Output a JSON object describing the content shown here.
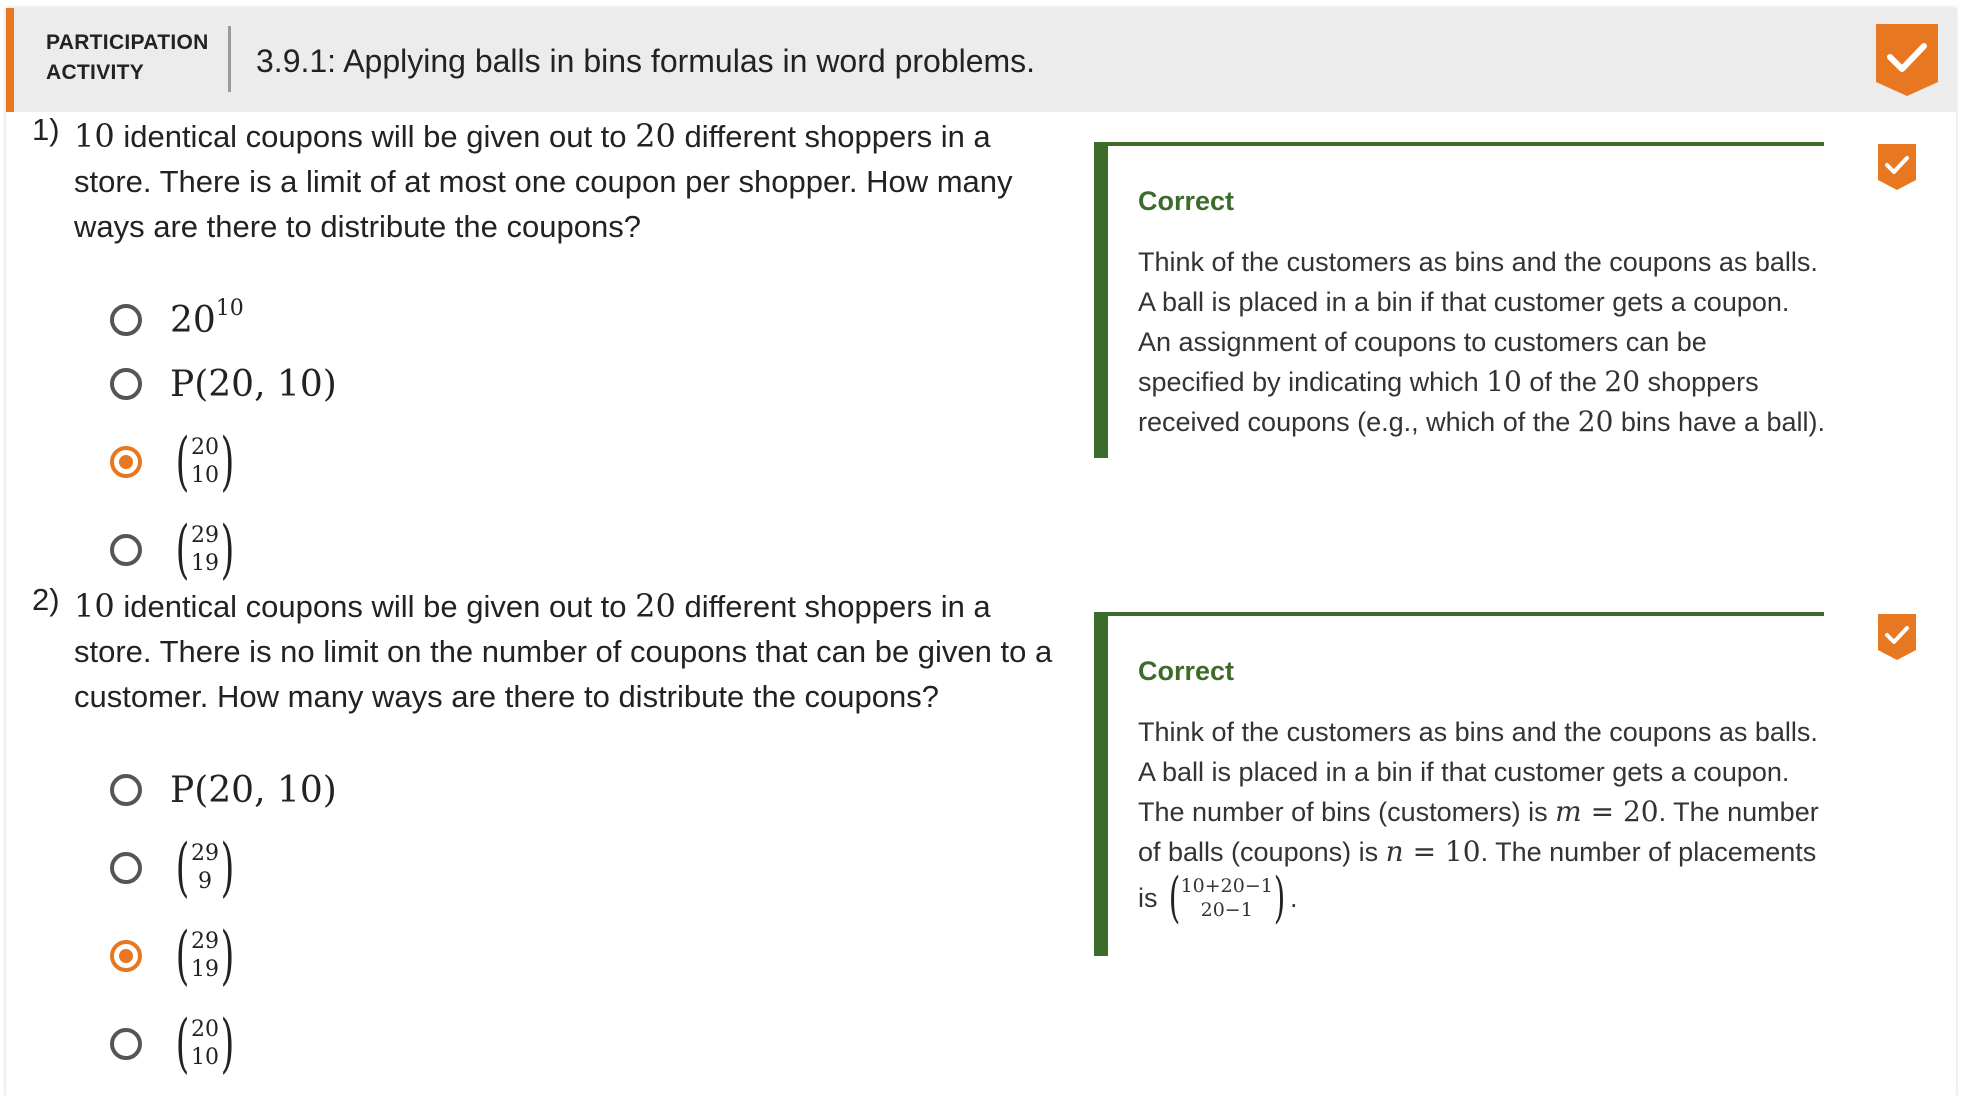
{
  "header": {
    "activity_line1": "PARTICIPATION",
    "activity_line2": "ACTIVITY",
    "title": "3.9.1: Applying balls in bins formulas in word problems.",
    "complete_icon": "checkmark-badge-icon",
    "accent_color": "#e87722"
  },
  "questions": [
    {
      "number": "1)",
      "text_n1": "10",
      "text_part1": " identical coupons will be given out to ",
      "text_n2": "20",
      "text_part2": " different shoppers in a store. There is a limit of at most one coupon per shopper. How many ways are there to distribute the coupons?",
      "options": [
        {
          "base": "20",
          "exp": "10",
          "selected": false
        },
        {
          "perm": "P(20, 10)",
          "selected": false
        },
        {
          "top": "20",
          "bottom": "10",
          "selected": true
        },
        {
          "top": "29",
          "bottom": "19",
          "selected": false
        }
      ],
      "feedback": {
        "title": "Correct",
        "line1": "Think of the customers as bins and the coupons as balls.",
        "line2": "A ball is placed in a bin if that customer gets a coupon.",
        "line3": "An assignment of coupons to customers can be",
        "line4_a": "specified by indicating which ",
        "line4_n1": "10",
        "line4_b": " of the ",
        "line4_n2": "20",
        "line4_c": " shoppers",
        "line5_a": "received coupons (e.g., which of the ",
        "line5_n": "20",
        "line5_b": " bins have a ball)."
      },
      "status_icon": "check-icon"
    },
    {
      "number": "2)",
      "text_n1": "10",
      "text_part1": " identical coupons will be given out to ",
      "text_n2": "20",
      "text_part2": " different shoppers in a store. There is no limit on the number of coupons that can be given to a customer. How many ways are there to distribute the coupons?",
      "options": [
        {
          "perm": "P(20, 10)",
          "selected": false
        },
        {
          "top": "29",
          "bottom": "9",
          "selected": false
        },
        {
          "top": "29",
          "bottom": "19",
          "selected": true
        },
        {
          "top": "20",
          "bottom": "10",
          "selected": false
        }
      ],
      "feedback": {
        "title": "Correct",
        "line1": "Think of the customers as bins and the coupons as balls.",
        "line2": "A ball is placed in a bin if that customer gets a coupon.",
        "line3_a": "The number of bins (customers) is ",
        "line3_var": "m",
        "line3_eq": " = 20",
        "line3_b": ". The number",
        "line4_a": "of balls (coupons) is ",
        "line4_var": "n",
        "line4_eq": " = 10",
        "line4_b": ". The number of placements",
        "line5_a": "is ",
        "line5_top": "10+20−1",
        "line5_bottom": "20−1",
        "line5_b": "."
      },
      "status_icon": "check-icon"
    }
  ]
}
